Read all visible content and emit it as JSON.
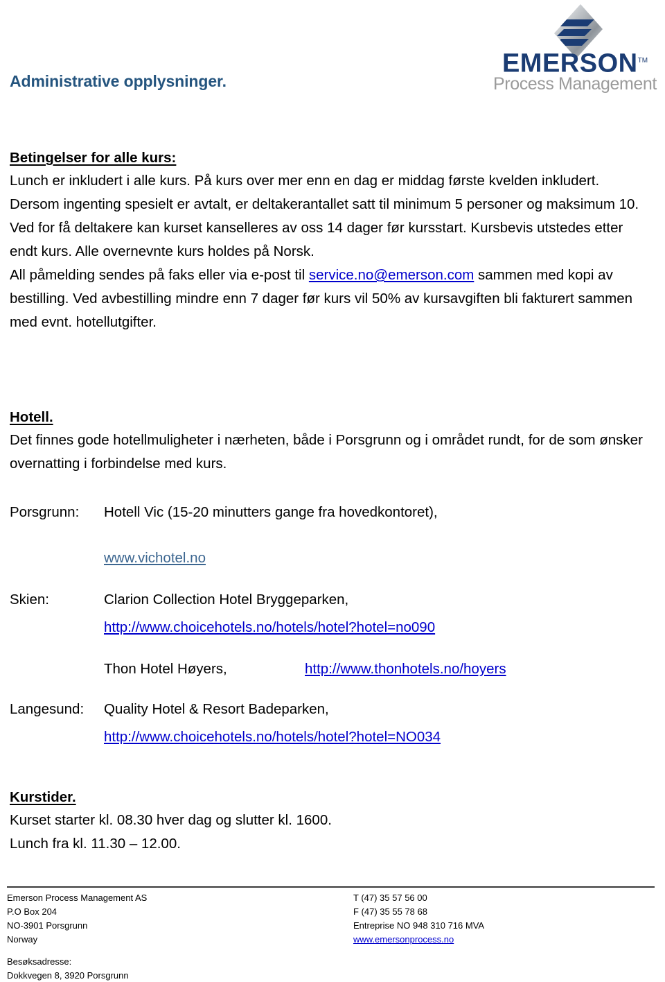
{
  "document": {
    "title": "Administrative opplysninger."
  },
  "logo": {
    "mark": "emerson-diamond-logo",
    "wordmark": "EMERSON",
    "trademark": "TM",
    "tagline": "Process Management"
  },
  "sections": {
    "terms": {
      "heading": "Betingelser for alle kurs:",
      "paragraph_part1": "Lunch er inkludert i alle kurs. På kurs over mer enn en dag er middag første kvelden inkludert. Dersom ingenting spesielt er avtalt, er deltakerantallet satt til minimum 5 personer og maksimum 10. Ved for få deltakere kan kurset kanselleres av oss 14 dager før kursstart. Kursbevis utstedes etter endt kurs.  Alle overnevnte kurs holdes på Norsk.",
      "paragraph_part2_pre": "All påmelding sendes på faks eller via e-post til ",
      "email": "service.no@emerson.com",
      "paragraph_part2_post": " sammen med kopi av bestilling. Ved avbestilling mindre enn 7 dager før kurs vil 50% av kursavgiften bli fakturert sammen med evnt. hotellutgifter."
    },
    "hotel": {
      "heading": "Hotell.",
      "intro": "Det finnes gode hotellmuligheter i nærheten, både i Porsgrunn og i området rundt, for de som ønsker overnatting i forbindelse med kurs.",
      "rows": [
        {
          "label": "Porsgrunn:",
          "name": "Hotell Vic (15-20 minutters gange fra hovedkontoret),",
          "url": "www.vichotel.no"
        },
        {
          "label": "Skien:",
          "name": "Clarion Collection Hotel Bryggeparken,",
          "url": "http://www.choicehotels.no/hotels/hotel?hotel=no090"
        },
        {
          "label": "",
          "name": "Thon Hotel Høyers,",
          "url": "http://www.thonhotels.no/hoyers"
        },
        {
          "label": "Langesund:",
          "name": "Quality Hotel & Resort Badeparken,",
          "url": "http://www.choicehotels.no/hotels/hotel?hotel=NO034"
        }
      ]
    },
    "times": {
      "heading": "Kurstider.",
      "line1": "Kurset starter kl. 08.30 hver dag og slutter kl. 1600.",
      "line2": "Lunch fra kl. 11.30 – 12.00."
    }
  },
  "footer": {
    "left": [
      "Emerson Process Management AS",
      "P.O Box 204",
      "NO-3901 Porsgrunn",
      "Norway"
    ],
    "right": [
      "T (47) 35 57 56 00",
      "F (47) 35 55 78 68",
      "Entreprise NO 948 310 716 MVA"
    ],
    "website": "www.emersonprocess.no",
    "visit_label": "Besøksadresse:",
    "visit_address": "Dokkvegen 8, 3920 Porsgrunn"
  },
  "colors": {
    "title_blue": "#24547E",
    "link_blue": "#0000CC",
    "link_steel": "#3C6690",
    "logo_blue": "#1B3C73",
    "logo_gray": "#9B9B9B"
  }
}
